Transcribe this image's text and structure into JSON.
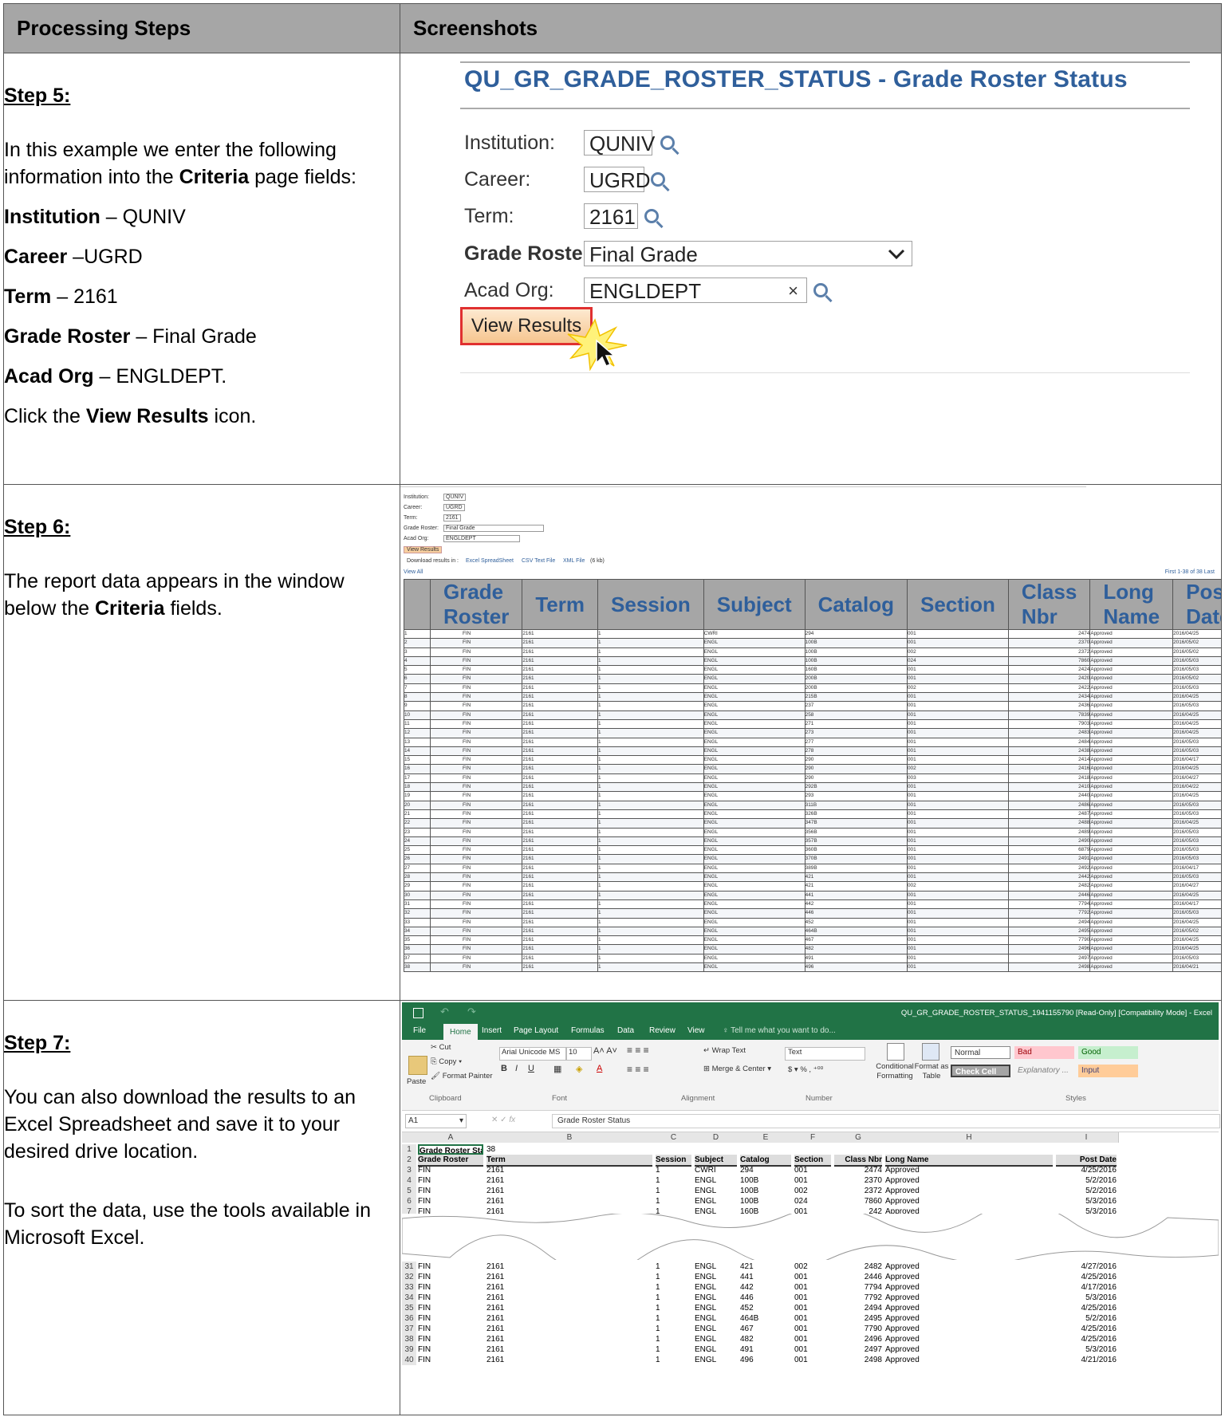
{
  "headers": {
    "left": "Processing Steps",
    "right": "Screenshots"
  },
  "step5": {
    "heading": "Step 5:",
    "intro_pre": "In this example we enter the following information into the ",
    "intro_bold": "Criteria",
    "intro_post": " page fields:",
    "lines": [
      {
        "label": "Institution",
        "value": " – QUNIV"
      },
      {
        "label": "Career",
        "value": " –UGRD"
      },
      {
        "label": "Term",
        "value": " – 2161"
      },
      {
        "label": "Grade Roster",
        "value": " – Final Grade"
      },
      {
        "label": "Acad Org",
        "value": " – ENGLDEPT."
      }
    ],
    "click_pre": "Click the ",
    "click_bold": "View Results",
    "click_post": " icon.",
    "shot": {
      "title": "QU_GR_GRADE_ROSTER_STATUS - Grade Roster Status",
      "institution_label": "Institution:",
      "institution_value": "QUNIV",
      "career_label": "Career:",
      "career_value": "UGRD",
      "term_label": "Term:",
      "term_value": "2161",
      "roster_label": "Grade Roster:",
      "roster_value": "Final Grade",
      "acad_label": "Acad Org:",
      "acad_value": "ENGLDEPT",
      "view_button": "View Results"
    }
  },
  "step6": {
    "heading": "Step 6:",
    "text_pre": "The report data appears in the window below the ",
    "text_bold": "Criteria",
    "text_post": " fields.",
    "shot": {
      "institution_label": "Institution:",
      "institution_value": "QUNIV",
      "career_label": "Career:",
      "career_value": "UGRD",
      "term_label": "Term:",
      "term_value": "2161",
      "roster_label": "Grade Roster:",
      "roster_value": "Final Grade",
      "acad_label": "Acad Org:",
      "acad_value": "ENGLDEPT",
      "view_button": "View Results",
      "download_label": "Download results in :",
      "excel_link": "Excel SpreadSheet",
      "csv_link": "CSV Text File",
      "xml_link": "XML File",
      "size": "(6 kb)",
      "view_all": "View All",
      "paging": "First  1-38 of 38  Last",
      "columns": [
        "",
        "Grade Roster",
        "Term",
        "Session",
        "Subject",
        "Catalog",
        "Section",
        "Class Nbr",
        "Long Name",
        "Post Date"
      ],
      "rows": [
        [
          "1",
          "FIN",
          "2161",
          "1",
          "CWRI",
          "294",
          "001",
          "2474",
          "Approved",
          "2016/04/25"
        ],
        [
          "2",
          "FIN",
          "2161",
          "1",
          "ENGL",
          "100B",
          "001",
          "2370",
          "Approved",
          "2016/05/02"
        ],
        [
          "3",
          "FIN",
          "2161",
          "1",
          "ENGL",
          "100B",
          "002",
          "2372",
          "Approved",
          "2016/05/02"
        ],
        [
          "4",
          "FIN",
          "2161",
          "1",
          "ENGL",
          "100B",
          "024",
          "7860",
          "Approved",
          "2016/05/03"
        ],
        [
          "5",
          "FIN",
          "2161",
          "1",
          "ENGL",
          "160B",
          "001",
          "2424",
          "Approved",
          "2016/05/03"
        ],
        [
          "6",
          "FIN",
          "2161",
          "1",
          "ENGL",
          "200B",
          "001",
          "2420",
          "Approved",
          "2016/05/02"
        ],
        [
          "7",
          "FIN",
          "2161",
          "1",
          "ENGL",
          "200B",
          "002",
          "2422",
          "Approved",
          "2016/05/03"
        ],
        [
          "8",
          "FIN",
          "2161",
          "1",
          "ENGL",
          "215B",
          "001",
          "2434",
          "Approved",
          "2016/04/25"
        ],
        [
          "9",
          "FIN",
          "2161",
          "1",
          "ENGL",
          "237",
          "001",
          "2436",
          "Approved",
          "2016/05/03"
        ],
        [
          "10",
          "FIN",
          "2161",
          "1",
          "ENGL",
          "258",
          "001",
          "7839",
          "Approved",
          "2016/04/25"
        ],
        [
          "11",
          "FIN",
          "2161",
          "1",
          "ENGL",
          "271",
          "001",
          "7903",
          "Approved",
          "2016/04/25"
        ],
        [
          "12",
          "FIN",
          "2161",
          "1",
          "ENGL",
          "273",
          "001",
          "2483",
          "Approved",
          "2016/04/25"
        ],
        [
          "13",
          "FIN",
          "2161",
          "1",
          "ENGL",
          "277",
          "001",
          "2484",
          "Approved",
          "2016/05/03"
        ],
        [
          "14",
          "FIN",
          "2161",
          "1",
          "ENGL",
          "278",
          "001",
          "2438",
          "Approved",
          "2016/05/03"
        ],
        [
          "15",
          "FIN",
          "2161",
          "1",
          "ENGL",
          "290",
          "001",
          "2414",
          "Approved",
          "2016/04/17"
        ],
        [
          "16",
          "FIN",
          "2161",
          "1",
          "ENGL",
          "290",
          "002",
          "2416",
          "Approved",
          "2016/04/25"
        ],
        [
          "17",
          "FIN",
          "2161",
          "1",
          "ENGL",
          "290",
          "003",
          "2418",
          "Approved",
          "2016/04/27"
        ],
        [
          "18",
          "FIN",
          "2161",
          "1",
          "ENGL",
          "292B",
          "001",
          "2410",
          "Approved",
          "2016/04/22"
        ],
        [
          "19",
          "FIN",
          "2161",
          "1",
          "ENGL",
          "293",
          "001",
          "2440",
          "Approved",
          "2016/04/25"
        ],
        [
          "20",
          "FIN",
          "2161",
          "1",
          "ENGL",
          "311B",
          "001",
          "2486",
          "Approved",
          "2016/05/03"
        ],
        [
          "21",
          "FIN",
          "2161",
          "1",
          "ENGL",
          "326B",
          "001",
          "2487",
          "Approved",
          "2016/05/03"
        ],
        [
          "22",
          "FIN",
          "2161",
          "1",
          "ENGL",
          "347B",
          "001",
          "2488",
          "Approved",
          "2016/04/25"
        ],
        [
          "23",
          "FIN",
          "2161",
          "1",
          "ENGL",
          "356B",
          "001",
          "2489",
          "Approved",
          "2016/05/03"
        ],
        [
          "24",
          "FIN",
          "2161",
          "1",
          "ENGL",
          "357B",
          "001",
          "2490",
          "Approved",
          "2016/05/03"
        ],
        [
          "25",
          "FIN",
          "2161",
          "1",
          "ENGL",
          "360B",
          "001",
          "6879",
          "Approved",
          "2016/05/03"
        ],
        [
          "26",
          "FIN",
          "2161",
          "1",
          "ENGL",
          "370B",
          "001",
          "2491",
          "Approved",
          "2016/05/03"
        ],
        [
          "27",
          "FIN",
          "2161",
          "1",
          "ENGL",
          "389B",
          "001",
          "2492",
          "Approved",
          "2016/04/17"
        ],
        [
          "28",
          "FIN",
          "2161",
          "1",
          "ENGL",
          "421",
          "001",
          "2442",
          "Approved",
          "2016/05/03"
        ],
        [
          "29",
          "FIN",
          "2161",
          "1",
          "ENGL",
          "421",
          "002",
          "2482",
          "Approved",
          "2016/04/27"
        ],
        [
          "30",
          "FIN",
          "2161",
          "1",
          "ENGL",
          "441",
          "001",
          "2446",
          "Approved",
          "2016/04/25"
        ],
        [
          "31",
          "FIN",
          "2161",
          "1",
          "ENGL",
          "442",
          "001",
          "7794",
          "Approved",
          "2016/04/17"
        ],
        [
          "32",
          "FIN",
          "2161",
          "1",
          "ENGL",
          "446",
          "001",
          "7792",
          "Approved",
          "2016/05/03"
        ],
        [
          "33",
          "FIN",
          "2161",
          "1",
          "ENGL",
          "452",
          "001",
          "2494",
          "Approved",
          "2016/04/25"
        ],
        [
          "34",
          "FIN",
          "2161",
          "1",
          "ENGL",
          "464B",
          "001",
          "2495",
          "Approved",
          "2016/05/02"
        ],
        [
          "35",
          "FIN",
          "2161",
          "1",
          "ENGL",
          "467",
          "001",
          "7790",
          "Approved",
          "2016/04/25"
        ],
        [
          "36",
          "FIN",
          "2161",
          "1",
          "ENGL",
          "482",
          "001",
          "2496",
          "Approved",
          "2016/04/25"
        ],
        [
          "37",
          "FIN",
          "2161",
          "1",
          "ENGL",
          "491",
          "001",
          "2497",
          "Approved",
          "2016/05/03"
        ],
        [
          "38",
          "FIN",
          "2161",
          "1",
          "ENGL",
          "496",
          "001",
          "2498",
          "Approved",
          "2016/04/21"
        ]
      ]
    }
  },
  "step7": {
    "heading": "Step 7:",
    "para1": "You can also download the results to an Excel Spreadsheet and save it to your desired drive location.",
    "para2": "To sort the data, use the tools available in Microsoft Excel.",
    "excel": {
      "window_title": "QU_GR_GRADE_ROSTER_STATUS_1941155790  [Read-Only]  [Compatibility Mode] - Excel",
      "tabs": [
        "File",
        "Home",
        "Insert",
        "Page Layout",
        "Formulas",
        "Data",
        "Review",
        "View"
      ],
      "tell_me": "Tell me what you want to do...",
      "clipboard": {
        "paste": "Paste",
        "cut": "Cut",
        "copy": "Copy",
        "painter": "Format Painter",
        "group": "Clipboard"
      },
      "font": {
        "name": "Arial Unicode MS",
        "size": "10",
        "group": "Font"
      },
      "alignment": {
        "wrap": "Wrap Text",
        "merge": "Merge & Center",
        "group": "Alignment"
      },
      "number": {
        "format": "Text",
        "group": "Number"
      },
      "styles": {
        "cond": "Conditional Formatting",
        "table": "Format as Table",
        "normal": "Normal",
        "bad": "Bad",
        "good": "Good",
        "check": "Check Cell",
        "explanatory": "Explanatory ...",
        "input": "Input",
        "group": "Styles"
      },
      "name_box": "A1",
      "formula": "Grade Roster Status",
      "col_letters": [
        "A",
        "B",
        "C",
        "D",
        "E",
        "F",
        "G",
        "H",
        "I"
      ],
      "top_rows": [
        {
          "n": "1",
          "cells": [
            "Grade Roster Sta",
            "38",
            "",
            "",
            "",
            "",
            "",
            "",
            ""
          ]
        },
        {
          "n": "2",
          "cells": [
            "Grade Roster",
            "Term",
            "Session",
            "Subject",
            "Catalog",
            "Section",
            "Class Nbr",
            "Long Name",
            "Post Date"
          ]
        },
        {
          "n": "3",
          "cells": [
            "FIN",
            "2161",
            "1",
            "CWRI",
            "294",
            "001",
            "2474",
            "Approved",
            "4/25/2016"
          ]
        },
        {
          "n": "4",
          "cells": [
            "FIN",
            "2161",
            "1",
            "ENGL",
            "100B",
            "001",
            "2370",
            "Approved",
            "5/2/2016"
          ]
        },
        {
          "n": "5",
          "cells": [
            "FIN",
            "2161",
            "1",
            "ENGL",
            "100B",
            "002",
            "2372",
            "Approved",
            "5/2/2016"
          ]
        },
        {
          "n": "6",
          "cells": [
            "FIN",
            "2161",
            "1",
            "ENGL",
            "100B",
            "024",
            "7860",
            "Approved",
            "5/3/2016"
          ]
        },
        {
          "n": "7",
          "cells": [
            "FIN",
            "2161",
            "1",
            "ENGL",
            "160B",
            "001",
            "242",
            "Approved",
            "5/3/2016"
          ]
        }
      ],
      "bottom_rows": [
        {
          "n": "31",
          "cells": [
            "FIN",
            "2161",
            "1",
            "ENGL",
            "421",
            "002",
            "2482",
            "Approved",
            "4/27/2016"
          ]
        },
        {
          "n": "32",
          "cells": [
            "FIN",
            "2161",
            "1",
            "ENGL",
            "441",
            "001",
            "2446",
            "Approved",
            "4/25/2016"
          ]
        },
        {
          "n": "33",
          "cells": [
            "FIN",
            "2161",
            "1",
            "ENGL",
            "442",
            "001",
            "7794",
            "Approved",
            "4/17/2016"
          ]
        },
        {
          "n": "34",
          "cells": [
            "FIN",
            "2161",
            "1",
            "ENGL",
            "446",
            "001",
            "7792",
            "Approved",
            "5/3/2016"
          ]
        },
        {
          "n": "35",
          "cells": [
            "FIN",
            "2161",
            "1",
            "ENGL",
            "452",
            "001",
            "2494",
            "Approved",
            "4/25/2016"
          ]
        },
        {
          "n": "36",
          "cells": [
            "FIN",
            "2161",
            "1",
            "ENGL",
            "464B",
            "001",
            "2495",
            "Approved",
            "5/2/2016"
          ]
        },
        {
          "n": "37",
          "cells": [
            "FIN",
            "2161",
            "1",
            "ENGL",
            "467",
            "001",
            "7790",
            "Approved",
            "4/25/2016"
          ]
        },
        {
          "n": "38",
          "cells": [
            "FIN",
            "2161",
            "1",
            "ENGL",
            "482",
            "001",
            "2496",
            "Approved",
            "4/25/2016"
          ]
        },
        {
          "n": "39",
          "cells": [
            "FIN",
            "2161",
            "1",
            "ENGL",
            "491",
            "001",
            "2497",
            "Approved",
            "5/3/2016"
          ]
        },
        {
          "n": "40",
          "cells": [
            "FIN",
            "2161",
            "1",
            "ENGL",
            "496",
            "001",
            "2498",
            "Approved",
            "4/21/2016"
          ]
        }
      ]
    }
  }
}
